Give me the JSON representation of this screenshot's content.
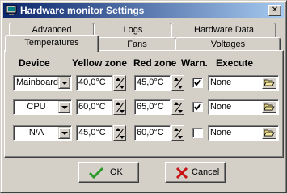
{
  "window": {
    "title": "Hardware monitor Settings"
  },
  "tabs": {
    "advanced": "Advanced",
    "logs": "Logs",
    "hardware_data": "Hardware Data",
    "temperatures": "Temperatures",
    "fans": "Fans",
    "voltages": "Voltages",
    "active": "Temperatures"
  },
  "headers": {
    "device": "Device",
    "yellow_zone": "Yellow zone",
    "red_zone": "Red zone",
    "warn": "Warn.",
    "execute": "Execute"
  },
  "rows": [
    {
      "device": "Mainboard",
      "yellow": "40,0°C",
      "red": "45,0°C",
      "warn": true,
      "execute": "None"
    },
    {
      "device": "CPU",
      "yellow": "60,0°C",
      "red": "65,0°C",
      "warn": true,
      "execute": "None"
    },
    {
      "device": "N/A",
      "yellow": "45,0°C",
      "red": "60,0°C",
      "warn": false,
      "execute": "None"
    }
  ],
  "buttons": {
    "ok": "OK",
    "cancel": "Cancel"
  },
  "colors": {
    "titlebar_start": "#0a246a",
    "titlebar_end": "#a6caf0",
    "ok_check": "#2e9a2e",
    "cancel_x": "#c81414",
    "face": "#d4d0c8"
  }
}
